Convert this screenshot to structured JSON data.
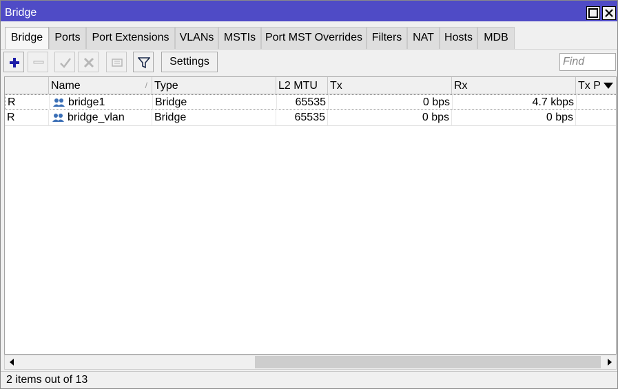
{
  "window": {
    "title": "Bridge"
  },
  "tabs": [
    {
      "label": "Bridge",
      "active": true
    },
    {
      "label": "Ports"
    },
    {
      "label": "Port Extensions"
    },
    {
      "label": "VLANs"
    },
    {
      "label": "MSTIs"
    },
    {
      "label": "Port MST Overrides"
    },
    {
      "label": "Filters"
    },
    {
      "label": "NAT"
    },
    {
      "label": "Hosts"
    },
    {
      "label": "MDB"
    }
  ],
  "toolbar": {
    "settings_label": "Settings",
    "find_placeholder": "Find",
    "icons": [
      "add-icon",
      "remove-icon",
      "enable-icon",
      "disable-icon",
      "comment-icon",
      "filter-icon"
    ]
  },
  "table": {
    "columns": [
      "",
      "Name",
      "Type",
      "L2 MTU",
      "Tx",
      "Rx",
      "Tx Pa"
    ],
    "sort_indicator": "/",
    "rows": [
      {
        "flag": "R",
        "name": "bridge1",
        "type": "Bridge",
        "l2mtu": "65535",
        "tx": "0 bps",
        "rx": "4.7 kbps"
      },
      {
        "flag": "R",
        "name": "bridge_vlan",
        "type": "Bridge",
        "l2mtu": "65535",
        "tx": "0 bps",
        "rx": "0 bps"
      }
    ]
  },
  "status": {
    "text": "2 items out of 13"
  },
  "colors": {
    "titlebar": "#4f4bc6",
    "accent_add": "#1c1ca8"
  }
}
